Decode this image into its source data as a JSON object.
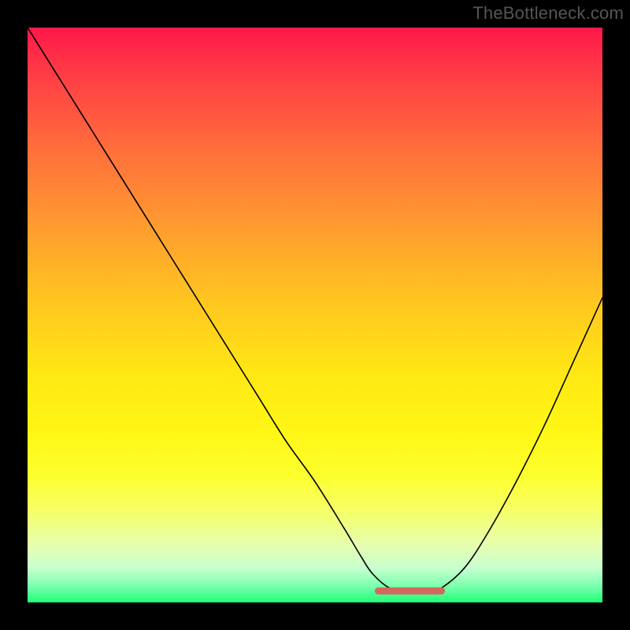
{
  "watermark_text": "TheBottleneck.com",
  "colors": {
    "frame": "#000000",
    "watermark": "#555555",
    "curve": "#000000",
    "flat_segment": "#d26a5c"
  },
  "chart_data": {
    "type": "line",
    "title": "",
    "xlabel": "",
    "ylabel": "",
    "xlim": [
      0,
      100
    ],
    "ylim": [
      0,
      100
    ],
    "grid": false,
    "legend": false,
    "series": [
      {
        "name": "bottleneck-curve",
        "x": [
          0,
          5,
          10,
          15,
          20,
          25,
          30,
          35,
          40,
          45,
          50,
          55,
          58,
          60,
          63,
          66,
          70,
          72,
          76,
          80,
          85,
          90,
          95,
          100
        ],
        "y": [
          100,
          92,
          84,
          76,
          68,
          60,
          52,
          44,
          36,
          28,
          21,
          13,
          8,
          5,
          2.5,
          2,
          2,
          2.5,
          6,
          12,
          21,
          31,
          42,
          53
        ]
      }
    ],
    "annotations": [
      {
        "name": "optimal-flat-zone",
        "x_range": [
          61,
          72
        ],
        "y": 2,
        "note": "plateau segment highlighted at minimum"
      }
    ]
  }
}
